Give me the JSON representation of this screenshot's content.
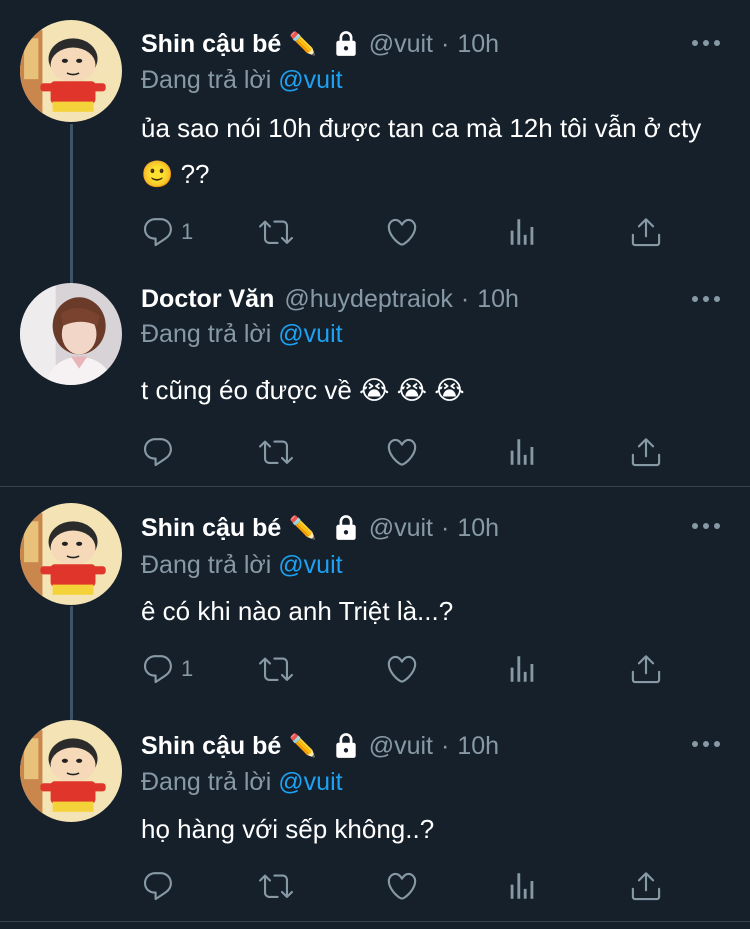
{
  "colors": {
    "background": "#15202b",
    "text_primary": "#ffffff",
    "text_secondary": "#8899a6",
    "accent": "#1da1f2",
    "divider": "#38444d",
    "thread_line": "#3d5466"
  },
  "replying_prefix": "Đang trả lời",
  "tweets": [
    {
      "name": "Shin cậu bé",
      "name_emoji": "✏️",
      "locked": true,
      "handle": "@vuit",
      "separator": "·",
      "time": "10h",
      "replying_to": "@vuit",
      "text": "ủa sao nói 10h được tan ca mà 12h tôi vẫn ở cty🙂 ??",
      "reply_count": "1",
      "avatar": "shin-chan-avatar"
    },
    {
      "name": "Doctor Văn",
      "name_emoji": "",
      "locked": false,
      "handle": "@huydeptraiok",
      "separator": "·",
      "time": "10h",
      "replying_to": "@vuit",
      "text": "t cũng éo được về 😭  😭 😭",
      "reply_count": "",
      "avatar": "person-avatar"
    },
    {
      "name": "Shin cậu bé",
      "name_emoji": "✏️",
      "locked": true,
      "handle": "@vuit",
      "separator": "·",
      "time": "10h",
      "replying_to": "@vuit",
      "text": "ê có khi nào anh Triệt là...?",
      "reply_count": "1",
      "avatar": "shin-chan-avatar"
    },
    {
      "name": "Shin cậu bé",
      "name_emoji": "✏️",
      "locked": true,
      "handle": "@vuit",
      "separator": "·",
      "time": "10h",
      "replying_to": "@vuit",
      "text": "họ hàng với sếp không..?",
      "reply_count": "",
      "avatar": "shin-chan-avatar"
    }
  ]
}
